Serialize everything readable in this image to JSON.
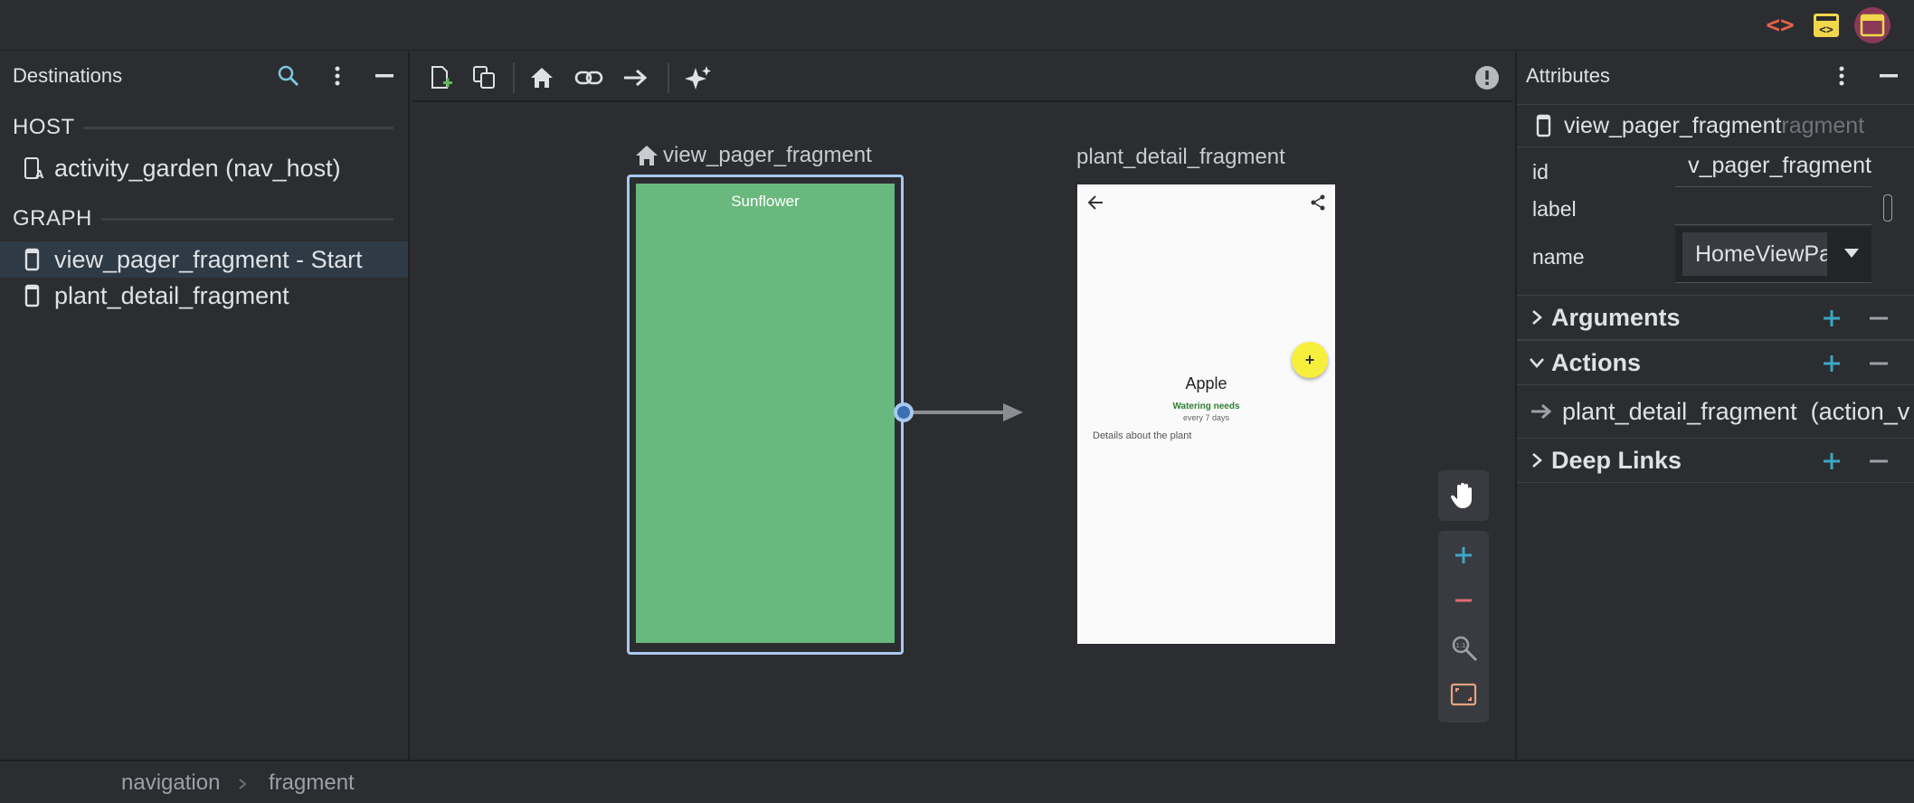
{
  "top_modes": [
    {
      "name": "code-mode",
      "label": "<>"
    },
    {
      "name": "split-mode",
      "label": "split"
    },
    {
      "name": "design-mode",
      "label": "design"
    }
  ],
  "destinations_panel": {
    "title": "Destinations",
    "host_section": "HOST",
    "host_item": "activity_garden (nav_host)",
    "graph_section": "GRAPH",
    "graph_items": [
      "view_pager_fragment - Start",
      "plant_detail_fragment"
    ]
  },
  "canvas": {
    "start_fragment": {
      "label": "view_pager_fragment",
      "preview_title": "Sunflower",
      "preview_color": "#69b87d"
    },
    "detail_fragment": {
      "label": "plant_detail_fragment",
      "plant_name": "Apple",
      "watering_title": "Watering needs",
      "watering_interval": "every 7 days",
      "description": "Details about the plant",
      "fab_label": "+"
    }
  },
  "attributes_panel": {
    "title": "Attributes",
    "selected_name": "view_pager_fragment",
    "selected_ghost": "ragment",
    "fields": {
      "id_label": "id",
      "id_value": "v_pager_fragment",
      "label_label": "label",
      "label_value": "",
      "name_label": "name",
      "name_value": "HomeViewPa"
    },
    "groups": {
      "arguments": "Arguments",
      "actions": "Actions",
      "deep_links": "Deep Links"
    },
    "action_item": "plant_detail_fragment  (action_v"
  },
  "breadcrumb": [
    "navigation",
    "fragment"
  ],
  "colors": {
    "accent_blue": "#a8c7fa",
    "selection_border": "#a8c8f0",
    "add_green": "#3ca7c6",
    "remove_red": "#e06c75",
    "fab_yellow": "#f6f03c"
  }
}
